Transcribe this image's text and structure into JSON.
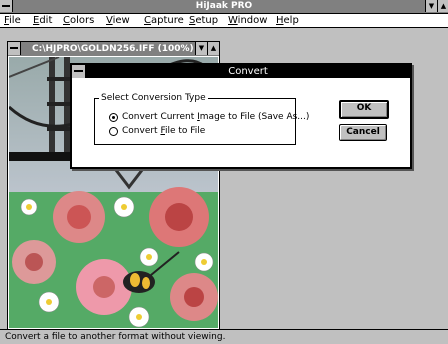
{
  "app": {
    "title": "HiJaak PRO"
  },
  "menu": [
    {
      "label": "File",
      "u": "F",
      "rest": "ile"
    },
    {
      "label": "Edit",
      "u": "E",
      "rest": "dit"
    },
    {
      "label": "Colors",
      "u": "C",
      "rest": "olors"
    },
    {
      "label": "View",
      "u": "V",
      "rest": "iew"
    },
    {
      "label": "Capture",
      "u": "C",
      "rest": "apture"
    },
    {
      "label": "Setup",
      "u": "S",
      "rest": "etup"
    },
    {
      "label": "Window",
      "u": "W",
      "rest": "indow"
    },
    {
      "label": "Help",
      "u": "H",
      "rest": "elp"
    }
  ],
  "child_window": {
    "title": "C:\\HJPRO\\GOLDN256.IFF (100%)"
  },
  "dialog": {
    "title": "Convert",
    "group_label": "Select Conversion Type",
    "option1": {
      "before": "Convert Current ",
      "u": "I",
      "after": "mage to File (Save As...)",
      "checked": true
    },
    "option2": {
      "before": "Convert ",
      "u": "F",
      "after": "ile to File",
      "checked": false
    },
    "ok_label": "OK",
    "cancel_label": "Cancel"
  },
  "status": {
    "text": "Convert a file to another format without viewing."
  },
  "icons": {
    "maximize": "▲",
    "minimize": "▼"
  },
  "colors": {
    "titlebar_inactive": "#808080",
    "titlebar_active": "#000000",
    "face": "#c0c0c0"
  }
}
